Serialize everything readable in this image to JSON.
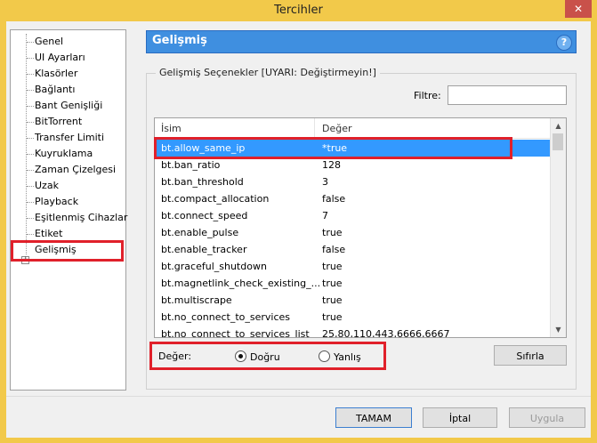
{
  "window": {
    "title": "Tercihler",
    "close": "✕"
  },
  "tree": {
    "items": [
      "Genel",
      "UI Ayarları",
      "Klasörler",
      "Bağlantı",
      "Bant Genişliği",
      "BitTorrent",
      "Transfer Limiti",
      "Kuyruklama",
      "Zaman Çizelgesi",
      "Uzak",
      "Playback",
      "Eşitlenmiş Cihazlar",
      "Etiket",
      "Gelişmiş"
    ],
    "expander": "+"
  },
  "panel": {
    "title": "Gelişmiş",
    "help": "?"
  },
  "group": {
    "legend": "Gelişmiş Seçenekler [UYARI: Değiştirmeyin!]"
  },
  "filter": {
    "label": "Filtre:",
    "value": ""
  },
  "list": {
    "columns": [
      "İsim",
      "Değer"
    ],
    "rows": [
      {
        "name": "bt.allow_same_ip",
        "value": "*true"
      },
      {
        "name": "bt.ban_ratio",
        "value": "128"
      },
      {
        "name": "bt.ban_threshold",
        "value": "3"
      },
      {
        "name": "bt.compact_allocation",
        "value": "false"
      },
      {
        "name": "bt.connect_speed",
        "value": "7"
      },
      {
        "name": "bt.enable_pulse",
        "value": "true"
      },
      {
        "name": "bt.enable_tracker",
        "value": "false"
      },
      {
        "name": "bt.graceful_shutdown",
        "value": "true"
      },
      {
        "name": "bt.magnetlink_check_existing_...",
        "value": "true"
      },
      {
        "name": "bt.multiscrape",
        "value": "true"
      },
      {
        "name": "bt.no_connect_to_services",
        "value": "true"
      },
      {
        "name": "bt.no_connect_to_services_list",
        "value": "25,80,110,443,6666,6667"
      }
    ]
  },
  "value_editor": {
    "label": "Değer:",
    "true_label": "Doğru",
    "false_label": "Yanlış",
    "reset": "Sıfırla"
  },
  "buttons": {
    "ok": "TAMAM",
    "cancel": "İptal",
    "apply": "Uygula"
  },
  "colors": {
    "highlight": "#e0202a",
    "selection": "#3399ff",
    "header": "#3f8fe0"
  }
}
